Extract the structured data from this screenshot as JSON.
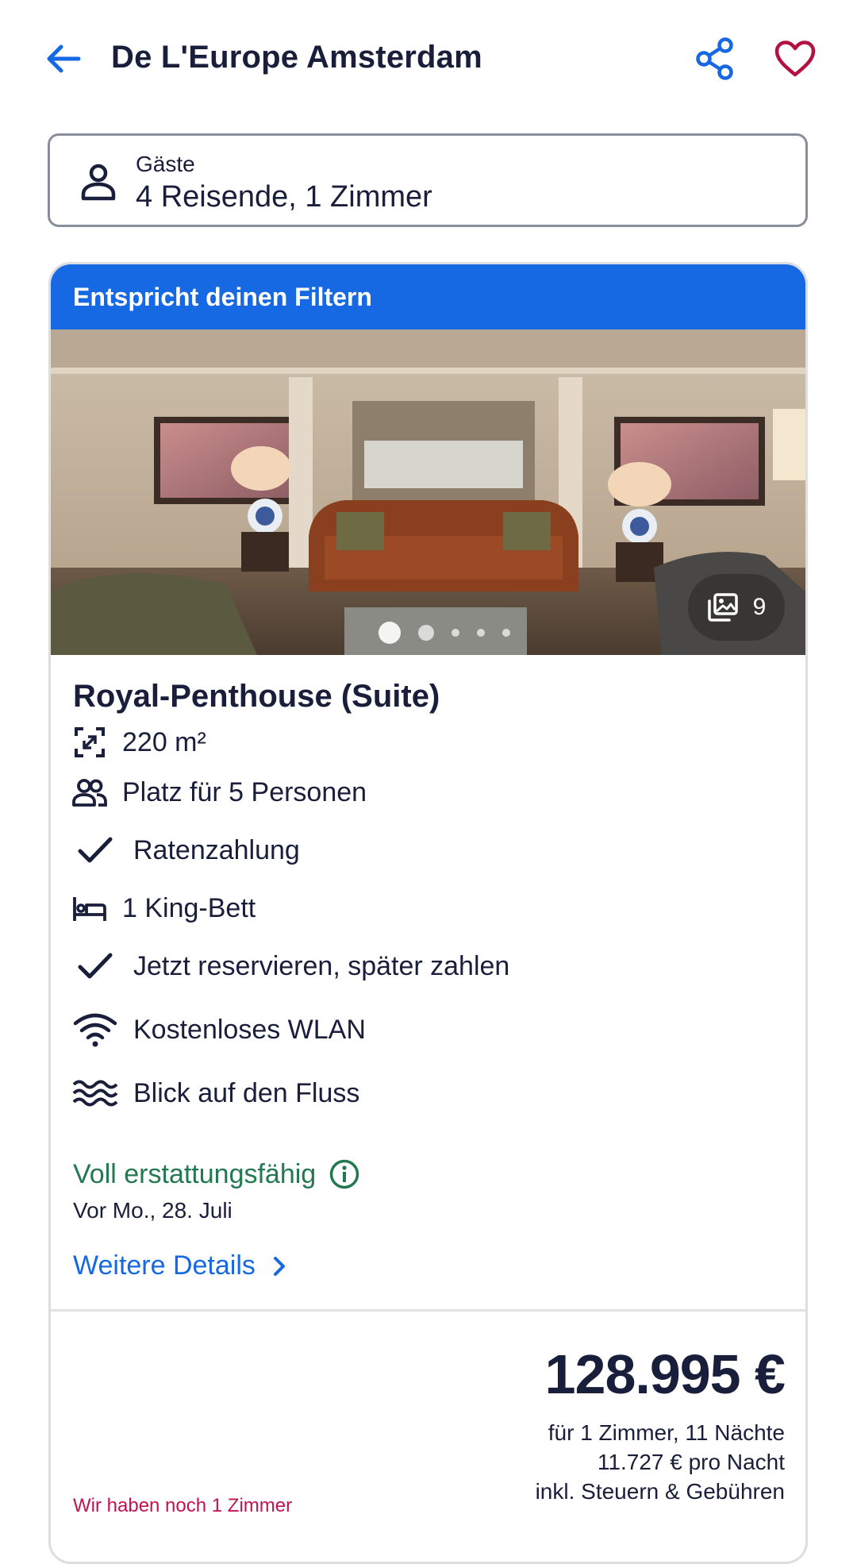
{
  "header": {
    "title": "De L'Europe Amsterdam",
    "back_icon": "arrow-left-icon",
    "share_icon": "share-icon",
    "favorite_icon": "heart-icon"
  },
  "guests": {
    "label": "Gäste",
    "value": "4 Reisende, 1 Zimmer",
    "icon": "person-icon"
  },
  "room": {
    "banner": "Entspricht deinen Filtern",
    "photo_count": "9",
    "photo_dots": 5,
    "photo_active_index": 0,
    "name": "Royal-Penthouse (Suite)",
    "features": [
      {
        "icon": "room-size-icon",
        "text": "220 m²"
      },
      {
        "icon": "people-icon",
        "text": "Platz für 5 Personen"
      },
      {
        "icon": "check-icon",
        "text": "Ratenzahlung"
      },
      {
        "icon": "bed-icon",
        "text": "1 King-Bett"
      },
      {
        "icon": "check-icon",
        "text": "Jetzt reservieren, später zahlen"
      },
      {
        "icon": "wifi-icon",
        "text": "Kostenloses WLAN"
      },
      {
        "icon": "water-icon",
        "text": "Blick auf den Fluss"
      }
    ],
    "refund_label": "Voll erstattungsfähig",
    "refund_date": "Vor Mo., 28. Juli",
    "details_link": "Weitere Details"
  },
  "pricing": {
    "total": "128.995 €",
    "line1": "für 1 Zimmer, 11 Nächte",
    "line2": "11.727 € pro Nacht",
    "line3": "inkl. Steuern & Gebühren",
    "availability": "Wir haben noch 1 Zimmer"
  },
  "colors": {
    "brand_blue": "#1668e3",
    "text_dark": "#191e3b",
    "refund_green": "#227950",
    "alert_red": "#c2134d",
    "favorite_red": "#b3113f"
  }
}
